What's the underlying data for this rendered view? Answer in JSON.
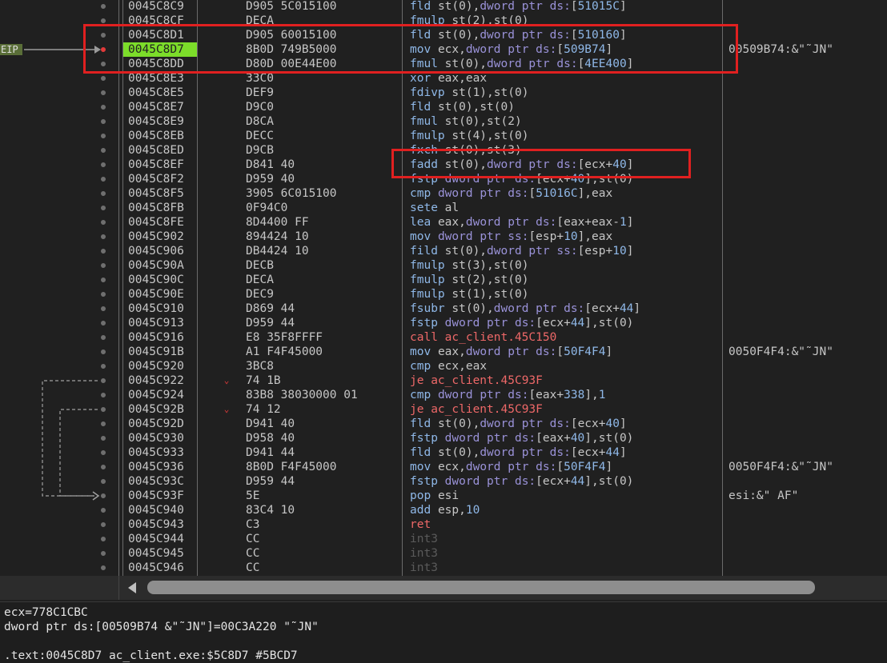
{
  "eip_label": "EIP",
  "rows": [
    {
      "addr": "0045C8C9",
      "bytes": "D905 5C015100",
      "mn": "fld",
      "args": [
        [
          "a",
          "st(0),"
        ],
        [
          "k",
          "dword ptr "
        ],
        [
          "k",
          "ds:"
        ],
        [
          "a",
          "["
        ],
        [
          "n",
          "51015C"
        ],
        [
          "a",
          "]"
        ]
      ],
      "cmt": ""
    },
    {
      "addr": "0045C8CF",
      "bytes": "DECA",
      "mn": "fmulp",
      "args": [
        [
          "a",
          "st(2),st(0)"
        ]
      ],
      "cmt": ""
    },
    {
      "addr": "0045C8D1",
      "bytes": "D905 60015100",
      "mn": "fld",
      "args": [
        [
          "a",
          "st(0),"
        ],
        [
          "k",
          "dword ptr "
        ],
        [
          "k",
          "ds:"
        ],
        [
          "a",
          "["
        ],
        [
          "n",
          "510160"
        ],
        [
          "a",
          "]"
        ]
      ],
      "cmt": ""
    },
    {
      "addr": "0045C8D7",
      "bytes": "8B0D 749B5000",
      "mn": "mov",
      "args": [
        [
          "a",
          "ecx,"
        ],
        [
          "k",
          "dword ptr "
        ],
        [
          "k",
          "ds:"
        ],
        [
          "a",
          "["
        ],
        [
          "n",
          "509B74"
        ],
        [
          "a",
          "]"
        ]
      ],
      "cmt": "00509B74:&\"˜JN\"",
      "current": true,
      "bp": true
    },
    {
      "addr": "0045C8DD",
      "bytes": "D80D 00E44E00",
      "mn": "fmul",
      "args": [
        [
          "a",
          "st(0),"
        ],
        [
          "k",
          "dword ptr "
        ],
        [
          "k",
          "ds:"
        ],
        [
          "a",
          "["
        ],
        [
          "n",
          "4EE400"
        ],
        [
          "a",
          "]"
        ]
      ],
      "cmt": ""
    },
    {
      "addr": "0045C8E3",
      "bytes": "33C0",
      "mn": "xor",
      "args": [
        [
          "a",
          "eax,eax"
        ]
      ],
      "cmt": ""
    },
    {
      "addr": "0045C8E5",
      "bytes": "DEF9",
      "mn": "fdivp",
      "args": [
        [
          "a",
          "st(1),st(0)"
        ]
      ],
      "cmt": ""
    },
    {
      "addr": "0045C8E7",
      "bytes": "D9C0",
      "mn": "fld",
      "args": [
        [
          "a",
          "st(0),st(0)"
        ]
      ],
      "cmt": ""
    },
    {
      "addr": "0045C8E9",
      "bytes": "D8CA",
      "mn": "fmul",
      "args": [
        [
          "a",
          "st(0),st(2)"
        ]
      ],
      "cmt": ""
    },
    {
      "addr": "0045C8EB",
      "bytes": "DECC",
      "mn": "fmulp",
      "args": [
        [
          "a",
          "st(4),st(0)"
        ]
      ],
      "cmt": ""
    },
    {
      "addr": "0045C8ED",
      "bytes": "D9CB",
      "mn": "fxch",
      "args": [
        [
          "a",
          "st(0),st(3)"
        ]
      ],
      "cmt": ""
    },
    {
      "addr": "0045C8EF",
      "bytes": "D841 40",
      "mn": "fadd",
      "args": [
        [
          "a",
          "st(0),"
        ],
        [
          "k",
          "dword ptr "
        ],
        [
          "k",
          "ds:"
        ],
        [
          "a",
          "[ecx+"
        ],
        [
          "n",
          "40"
        ],
        [
          "a",
          "]"
        ]
      ],
      "cmt": ""
    },
    {
      "addr": "0045C8F2",
      "bytes": "D959 40",
      "mn": "fstp",
      "args": [
        [
          "k",
          "dword ptr "
        ],
        [
          "k",
          "ds:"
        ],
        [
          "a",
          "[ecx+"
        ],
        [
          "n",
          "40"
        ],
        [
          "a",
          "],st(0)"
        ]
      ],
      "cmt": ""
    },
    {
      "addr": "0045C8F5",
      "bytes": "3905 6C015100",
      "mn": "cmp",
      "args": [
        [
          "k",
          "dword ptr "
        ],
        [
          "k",
          "ds:"
        ],
        [
          "a",
          "["
        ],
        [
          "n",
          "51016C"
        ],
        [
          "a",
          "],eax"
        ]
      ],
      "cmt": ""
    },
    {
      "addr": "0045C8FB",
      "bytes": "0F94C0",
      "mn": "sete",
      "args": [
        [
          "a",
          "al"
        ]
      ],
      "cmt": ""
    },
    {
      "addr": "0045C8FE",
      "bytes": "8D4400 FF",
      "mn": "lea",
      "args": [
        [
          "a",
          "eax,"
        ],
        [
          "k",
          "dword ptr "
        ],
        [
          "k",
          "ds:"
        ],
        [
          "a",
          "[eax+eax-"
        ],
        [
          "n",
          "1"
        ],
        [
          "a",
          "]"
        ]
      ],
      "cmt": ""
    },
    {
      "addr": "0045C902",
      "bytes": "894424 10",
      "mn": "mov",
      "args": [
        [
          "k",
          "dword ptr "
        ],
        [
          "k",
          "ss:"
        ],
        [
          "a",
          "[esp+"
        ],
        [
          "n",
          "10"
        ],
        [
          "a",
          "],eax"
        ]
      ],
      "cmt": ""
    },
    {
      "addr": "0045C906",
      "bytes": "DB4424 10",
      "mn": "fild",
      "args": [
        [
          "a",
          "st(0),"
        ],
        [
          "k",
          "dword ptr "
        ],
        [
          "k",
          "ss:"
        ],
        [
          "a",
          "[esp+"
        ],
        [
          "n",
          "10"
        ],
        [
          "a",
          "]"
        ]
      ],
      "cmt": ""
    },
    {
      "addr": "0045C90A",
      "bytes": "DECB",
      "mn": "fmulp",
      "args": [
        [
          "a",
          "st(3),st(0)"
        ]
      ],
      "cmt": ""
    },
    {
      "addr": "0045C90C",
      "bytes": "DECA",
      "mn": "fmulp",
      "args": [
        [
          "a",
          "st(2),st(0)"
        ]
      ],
      "cmt": ""
    },
    {
      "addr": "0045C90E",
      "bytes": "DEC9",
      "mn": "fmulp",
      "args": [
        [
          "a",
          "st(1),st(0)"
        ]
      ],
      "cmt": ""
    },
    {
      "addr": "0045C910",
      "bytes": "D869 44",
      "mn": "fsubr",
      "args": [
        [
          "a",
          "st(0),"
        ],
        [
          "k",
          "dword ptr "
        ],
        [
          "k",
          "ds:"
        ],
        [
          "a",
          "[ecx+"
        ],
        [
          "n",
          "44"
        ],
        [
          "a",
          "]"
        ]
      ],
      "cmt": ""
    },
    {
      "addr": "0045C913",
      "bytes": "D959 44",
      "mn": "fstp",
      "args": [
        [
          "k",
          "dword ptr "
        ],
        [
          "k",
          "ds:"
        ],
        [
          "a",
          "[ecx+"
        ],
        [
          "n",
          "44"
        ],
        [
          "a",
          "],st(0)"
        ]
      ],
      "cmt": ""
    },
    {
      "addr": "0045C916",
      "bytes": "E8 35F8FFFF",
      "mn": "call",
      "type": "call",
      "args": [
        [
          "r",
          "ac_client.45C150"
        ]
      ],
      "cmt": ""
    },
    {
      "addr": "0045C91B",
      "bytes": "A1 F4F45000",
      "mn": "mov",
      "args": [
        [
          "a",
          "eax,"
        ],
        [
          "k",
          "dword ptr "
        ],
        [
          "k",
          "ds:"
        ],
        [
          "a",
          "["
        ],
        [
          "n",
          "50F4F4"
        ],
        [
          "a",
          "]"
        ]
      ],
      "cmt": "0050F4F4:&\"˜JN\""
    },
    {
      "addr": "0045C920",
      "bytes": "3BC8",
      "mn": "cmp",
      "args": [
        [
          "a",
          "ecx,eax"
        ]
      ],
      "cmt": ""
    },
    {
      "addr": "0045C922",
      "bytes": "74 1B",
      "mn": "je",
      "type": "jmp",
      "args": [
        [
          "r",
          "ac_client.45C93F"
        ]
      ],
      "cmt": "",
      "jarrow": true
    },
    {
      "addr": "0045C924",
      "bytes": "83B8 38030000 01",
      "mn": "cmp",
      "args": [
        [
          "k",
          "dword ptr "
        ],
        [
          "k",
          "ds:"
        ],
        [
          "a",
          "[eax+"
        ],
        [
          "n",
          "338"
        ],
        [
          "a",
          "],"
        ],
        [
          "n",
          "1"
        ]
      ],
      "cmt": ""
    },
    {
      "addr": "0045C92B",
      "bytes": "74 12",
      "mn": "je",
      "type": "jmp",
      "args": [
        [
          "r",
          "ac_client.45C93F"
        ]
      ],
      "cmt": "",
      "jarrow": true
    },
    {
      "addr": "0045C92D",
      "bytes": "D941 40",
      "mn": "fld",
      "args": [
        [
          "a",
          "st(0),"
        ],
        [
          "k",
          "dword ptr "
        ],
        [
          "k",
          "ds:"
        ],
        [
          "a",
          "[ecx+"
        ],
        [
          "n",
          "40"
        ],
        [
          "a",
          "]"
        ]
      ],
      "cmt": ""
    },
    {
      "addr": "0045C930",
      "bytes": "D958 40",
      "mn": "fstp",
      "args": [
        [
          "k",
          "dword ptr "
        ],
        [
          "k",
          "ds:"
        ],
        [
          "a",
          "[eax+"
        ],
        [
          "n",
          "40"
        ],
        [
          "a",
          "],st(0)"
        ]
      ],
      "cmt": ""
    },
    {
      "addr": "0045C933",
      "bytes": "D941 44",
      "mn": "fld",
      "args": [
        [
          "a",
          "st(0),"
        ],
        [
          "k",
          "dword ptr "
        ],
        [
          "k",
          "ds:"
        ],
        [
          "a",
          "[ecx+"
        ],
        [
          "n",
          "44"
        ],
        [
          "a",
          "]"
        ]
      ],
      "cmt": ""
    },
    {
      "addr": "0045C936",
      "bytes": "8B0D F4F45000",
      "mn": "mov",
      "args": [
        [
          "a",
          "ecx,"
        ],
        [
          "k",
          "dword ptr "
        ],
        [
          "k",
          "ds:"
        ],
        [
          "a",
          "["
        ],
        [
          "n",
          "50F4F4"
        ],
        [
          "a",
          "]"
        ]
      ],
      "cmt": "0050F4F4:&\"˜JN\""
    },
    {
      "addr": "0045C93C",
      "bytes": "D959 44",
      "mn": "fstp",
      "args": [
        [
          "k",
          "dword ptr "
        ],
        [
          "k",
          "ds:"
        ],
        [
          "a",
          "[ecx+"
        ],
        [
          "n",
          "44"
        ],
        [
          "a",
          "],st(0)"
        ]
      ],
      "cmt": ""
    },
    {
      "addr": "0045C93F",
      "bytes": "5E",
      "mn": "pop",
      "args": [
        [
          "a",
          "esi"
        ]
      ],
      "cmt": "esi:&\" AF\""
    },
    {
      "addr": "0045C940",
      "bytes": "83C4 10",
      "mn": "add",
      "args": [
        [
          "a",
          "esp,"
        ],
        [
          "n",
          "10"
        ]
      ],
      "cmt": ""
    },
    {
      "addr": "0045C943",
      "bytes": "C3",
      "mn": "ret",
      "type": "ret",
      "args": [],
      "cmt": ""
    },
    {
      "addr": "0045C944",
      "bytes": "CC",
      "mn": "int3",
      "type": "int",
      "args": [],
      "cmt": ""
    },
    {
      "addr": "0045C945",
      "bytes": "CC",
      "mn": "int3",
      "type": "int",
      "args": [],
      "cmt": ""
    },
    {
      "addr": "0045C946",
      "bytes": "CC",
      "mn": "int3",
      "type": "int",
      "args": [],
      "cmt": ""
    }
  ],
  "info": {
    "line1": "ecx=778C1CBC",
    "line2": "dword ptr ds:[00509B74 &\"˜JN\"]=00C3A220 \"˜JN\"",
    "line3": "",
    "line4": ".text:0045C8D7 ac_client.exe:$5C8D7 #5BCD7"
  },
  "colors": {
    "background": "#202020",
    "current_address": "#7cdd2a",
    "breakpoint": "#e23a3a",
    "highlight_box": "#e02020",
    "mnemonic": "#8fb8e8",
    "keyword": "#9a92d8",
    "call": "#ee6868"
  }
}
